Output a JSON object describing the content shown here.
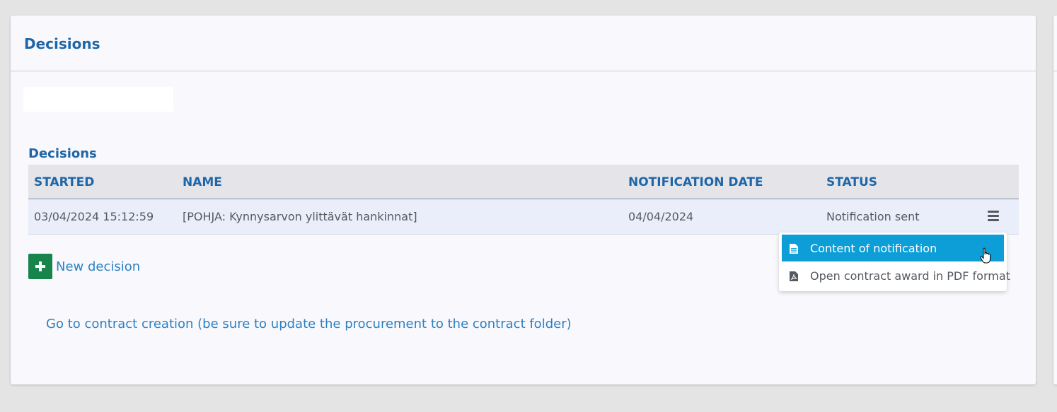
{
  "card": {
    "title": "Decisions"
  },
  "decisions": {
    "section_title": "Decisions",
    "columns": [
      "STARTED",
      "NAME",
      "NOTIFICATION DATE",
      "STATUS"
    ],
    "rows": [
      {
        "started": "03/04/2024 15:12:59",
        "name": "[POHJA: Kynnysarvon ylittävät hankinnat]",
        "notification_date": "04/04/2024",
        "status": "Notification sent"
      }
    ]
  },
  "actions": {
    "new_decision": "New decision",
    "contract_link": "Go to contract creation (be sure to update the procurement to the contract folder)"
  },
  "dropdown": {
    "items": [
      {
        "label": "Content of notification",
        "icon": "document-icon"
      },
      {
        "label": "Open contract award in PDF format",
        "icon": "pdf-icon"
      }
    ]
  },
  "colors": {
    "accent": "#1f66a8",
    "link": "#2d81c2",
    "active_item": "#0d9ed8",
    "add_button": "#17854b"
  }
}
